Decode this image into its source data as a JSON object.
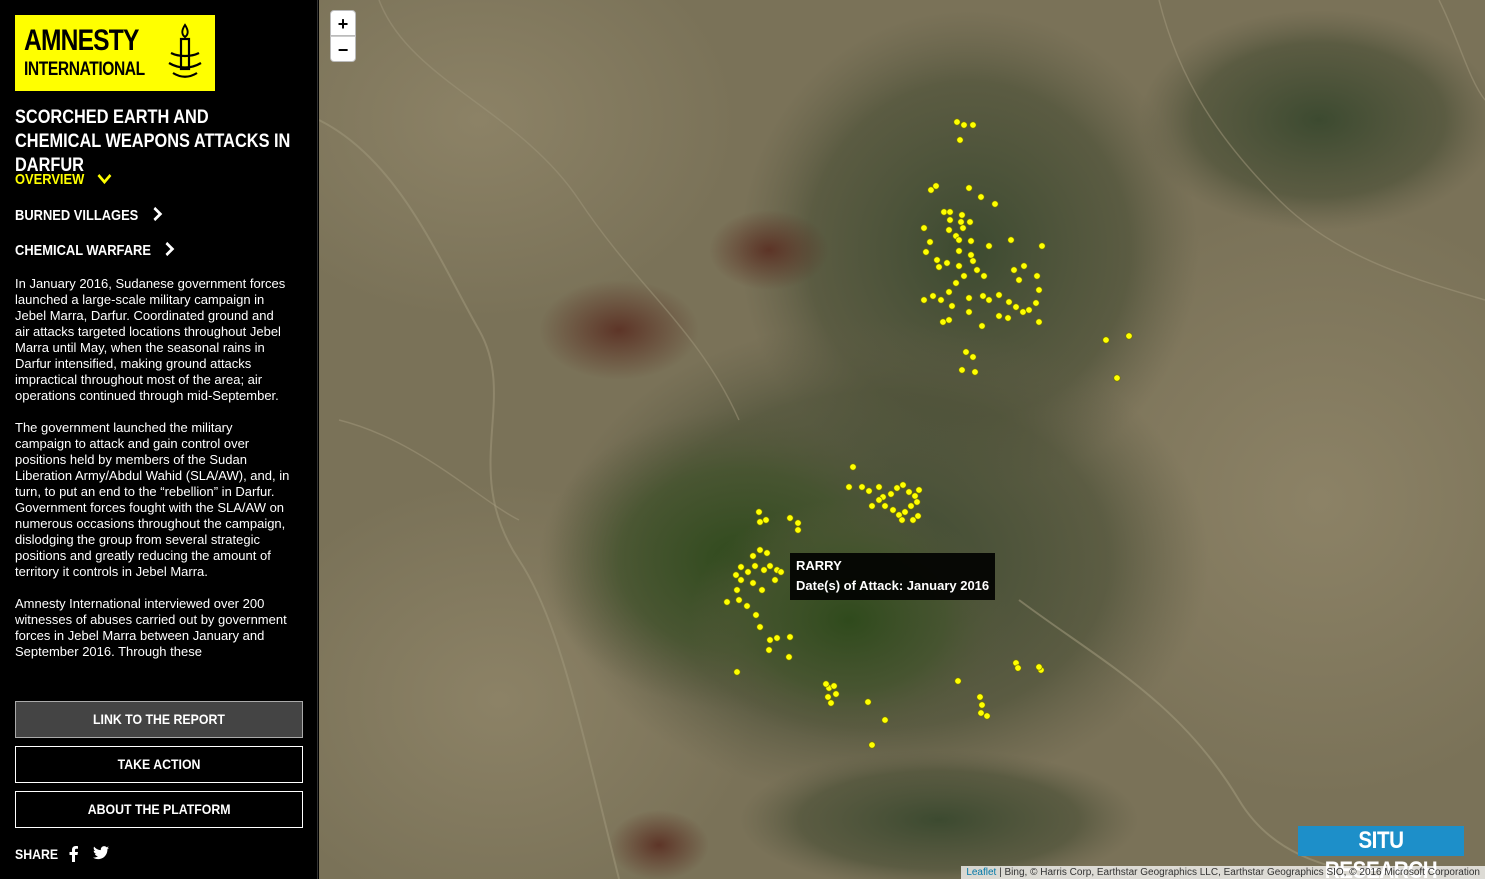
{
  "logo": {
    "line1": "AMNESTY",
    "line2": "INTERNATIONAL"
  },
  "title": "SCORCHED EARTH AND CHEMICAL WEAPONS ATTACKS IN DARFUR",
  "nav": [
    {
      "label": "OVERVIEW",
      "icon": "chevron-down-icon",
      "active": true
    },
    {
      "label": "BURNED VILLAGES",
      "icon": "chevron-right-icon",
      "active": false
    },
    {
      "label": "CHEMICAL WARFARE",
      "icon": "chevron-right-icon",
      "active": false
    }
  ],
  "description": [
    "In January 2016, Sudanese government forces launched a large-scale military campaign in Jebel Marra, Darfur. Coordinated ground and air attacks targeted locations throughout Jebel Marra until May, when the seasonal rains in Darfur intensified, making ground attacks impractical throughout most of the area; air operations continued through mid-September.",
    "The government launched the military campaign to attack and gain control over positions held by members of the Sudan Liberation Army/Abdul Wahid (SLA/AW), and, in turn, to put an end to the “rebellion” in Darfur. Government forces fought with the SLA/AW on numerous occasions throughout the campaign, dislodging the group from several strategic positions and greatly reducing the amount of territory it controls in Jebel Marra.",
    "Amnesty International interviewed over 200 witnesses of abuses carried out by government forces in Jebel Marra between January and September 2016. Through these"
  ],
  "buttons": {
    "report": "LINK TO THE REPORT",
    "action": "TAKE ACTION",
    "about": "ABOUT THE PLATFORM"
  },
  "share": {
    "label": "SHARE",
    "icons": [
      "facebook-icon",
      "twitter-icon"
    ]
  },
  "map": {
    "zoom_in": "+",
    "zoom_out": "−",
    "tooltip": {
      "name": "RARRY",
      "dates": "Date(s) of Attack: January 2016"
    },
    "branding": "SITU RESEARCH",
    "attribution_link": "Leaflet",
    "attribution_text": " | Bing, © Harris Corp, Earthstar Geographics LLC, Earthstar Geographics SIO, © 2016 Microsoft Corporation",
    "marker_color": "#ffff00"
  },
  "colors": {
    "accent": "#ffff00",
    "brand_blue": "#1d8fc9",
    "sidebar_bg": "#000000"
  }
}
